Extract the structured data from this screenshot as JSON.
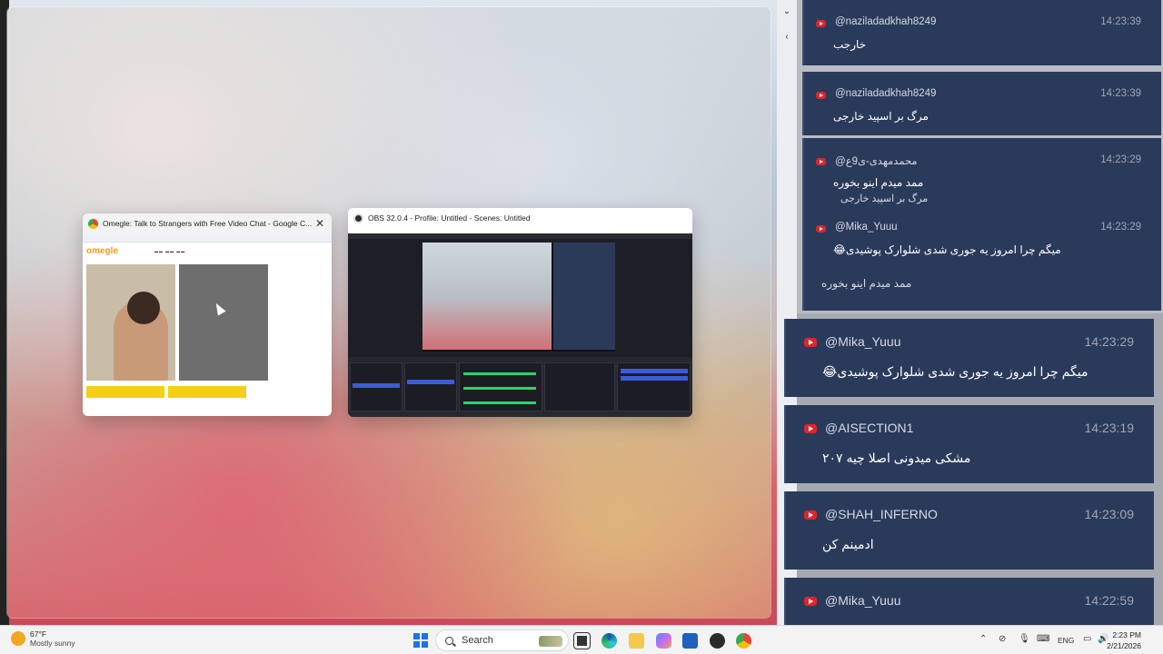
{
  "windows": {
    "chrome": {
      "title": "Omegle: Talk to Strangers with Free Video Chat - Google C...",
      "page_logo": "omegle",
      "close_glyph": "✕",
      "icon": "chrome-icon"
    },
    "obs": {
      "title": "OBS 32.0.4 - Profile: Untitled - Scenes: Untitled",
      "icon": "obs-icon"
    }
  },
  "chat": {
    "strip_icons": [
      "chevron-down-icon",
      "back-arrow-icon"
    ],
    "small_messages": [
      {
        "user": "@naziladadkhah8249",
        "time": "14:23:39",
        "text": "خارجب"
      },
      {
        "user": "@naziladadkhah8249",
        "time": "14:23:39",
        "text": "مرگ بر اسپید خارجی"
      },
      {
        "user": "@محمدمهدی-ی9ع",
        "time": "14:23:29",
        "text": "ممد میدم اینو بخوره"
      },
      {
        "user": "@Mika_Yuuu",
        "time": "14:23:29",
        "text": "میگم چرا امروز یه جوری شدی شلوارک پوشیدی😂"
      }
    ],
    "ghost_texts": [
      "مرگ بر اسپید خارجی",
      "ممد میدم اینو بخوره"
    ],
    "big_messages": [
      {
        "user": "@Mika_Yuuu",
        "time": "14:23:29",
        "text": "میگم چرا امروز یه جوری شدی شلوارک پوشیدی😂"
      },
      {
        "user": "@AISECTION1",
        "time": "14:23:19",
        "text": "مشکی میدونی اصلا چیه ۲۰۷"
      },
      {
        "user": "@SHAH_INFERNO",
        "time": "14:23:09",
        "text": "ادمینم کن"
      },
      {
        "user": "@Mika_Yuuu",
        "time": "14:22:59",
        "text": ""
      }
    ],
    "colors": {
      "message_bg": "#2a3a5a",
      "youtube_red": "#e0242b"
    }
  },
  "taskbar": {
    "weather_temp": "67°F",
    "weather_condition": "Mostly sunny",
    "search_label": "Search",
    "language": "ENG",
    "time": "2:23 PM",
    "date": "2/21/2026",
    "pinned": [
      "file-explorer-icon",
      "edge-icon",
      "folder-icon",
      "copilot-icon",
      "store-icon",
      "obs-icon",
      "chrome-icon"
    ]
  }
}
